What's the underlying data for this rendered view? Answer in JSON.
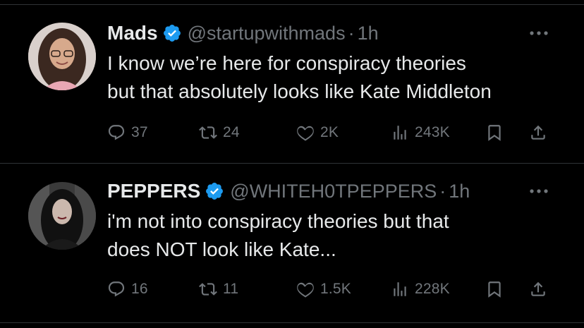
{
  "colors": {
    "background": "#000000",
    "text_primary": "#e7e9ea",
    "text_secondary": "#71767b",
    "verified_badge": "#1d9bf0",
    "divider": "#2f3336"
  },
  "tweets": [
    {
      "name": "Mads",
      "handle": "@startupwithmads",
      "separator": "·",
      "time": "1h",
      "text_lines": [
        "I know we’re here for conspiracy theories",
        "but that absolutely looks like Kate Middleton"
      ],
      "replies": "37",
      "retweets": "24",
      "likes": "2K",
      "views": "243K"
    },
    {
      "name": "PEPPERS",
      "handle": "@WHITEH0TPEPPERS",
      "separator": "·",
      "time": "1h",
      "text_lines": [
        "i'm not into conspiracy theories but that",
        "does NOT look like Kate..."
      ],
      "replies": "16",
      "retweets": "11",
      "likes": "1.5K",
      "views": "228K"
    }
  ],
  "icons": {
    "verified": "verified-badge-icon",
    "more": "more-options-icon",
    "reply": "reply-icon",
    "retweet": "retweet-icon",
    "like": "like-icon",
    "views": "views-icon",
    "bookmark": "bookmark-icon",
    "share": "share-icon"
  }
}
